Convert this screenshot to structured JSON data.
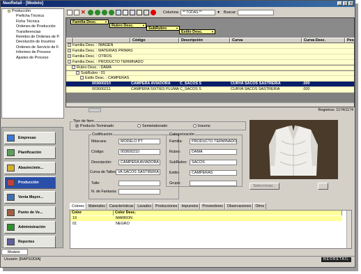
{
  "window": {
    "title": "NeoRetail - [Modelo]",
    "brand": "NEORETAIL"
  },
  "tree": {
    "root": "Producción",
    "items": [
      "Preficha Técnica",
      "Ficha Técnica",
      "Ordenes de Producción",
      "Transferencias",
      "Remitos de Ordenes de P.",
      "Devolución de Insumos",
      "Ordenes de Servicio de F.",
      "Informes de Proceso",
      "Ajustes de Proceso"
    ]
  },
  "sidebar": {
    "items": [
      {
        "label": "Empresas",
        "color": "#3a78d4"
      },
      {
        "label": "Planificación",
        "color": "#5aa05a"
      },
      {
        "label": "Abastecimie...",
        "color": "#d4b030"
      },
      {
        "label": "Producción",
        "color": "#c04040"
      },
      {
        "label": "Venta Mayor...",
        "color": "#4070b0"
      },
      {
        "label": "Punto de Ve...",
        "color": "#a06040"
      },
      {
        "label": "Administración",
        "color": "#309030"
      },
      {
        "label": "Reportes",
        "color": "#6060a0"
      }
    ],
    "selected": "Producción"
  },
  "module_tab": "Modelo",
  "status": {
    "user": "Usuario: [RAPSODIA]"
  },
  "toolbar": {
    "columna_label": "Columna:",
    "columna_value": "** TODAS **",
    "buscar_label": "Buscar:"
  },
  "group_buttons": [
    "Familia Desc.",
    "Rubro Desc.",
    "SubRubro",
    "Estilo Desc."
  ],
  "grid": {
    "columns": [
      "Código",
      "Descripción",
      "Curva",
      "Curva Desc.",
      "Peso"
    ],
    "groups": [
      {
        "text": "Familia Desc. : IMAGEN",
        "sign": "+"
      },
      {
        "text": "Familia Desc. : MATERIAS PRIMAS",
        "sign": "+"
      },
      {
        "text": "Familia Desc. : OTROS",
        "sign": "+"
      },
      {
        "text": "Familia Desc. : PRODUCTO TERMINADO",
        "sign": "-"
      },
      {
        "text": "Rubro Desc. : DAMA",
        "sign": "-"
      },
      {
        "text": "SubRubro : 01",
        "sign": "-"
      },
      {
        "text": "Estilo Desc. : CAMPERAS",
        "sign": "-"
      }
    ],
    "rows": [
      {
        "codigo": "003600210",
        "desc": "CAMPERA AVIADORA",
        "curva": "C_SACOS S",
        "curva_desc": "CURVA SACOS SASTRERIA",
        "peso": ".000",
        "selected": true
      },
      {
        "codigo": "003600211",
        "desc": "CAMPERA SIXTIES PLUMAS",
        "curva": "C_SACOS S",
        "curva_desc": "CURVA SACOS SASTRERIA",
        "peso": ".000",
        "selected": false
      }
    ],
    "registros": "Registros: 1174/1174"
  },
  "form": {
    "tipo_legend": "Tipo de Item",
    "radios": [
      {
        "label": "Producto Terminado",
        "on": true
      },
      {
        "label": "Semielaborado",
        "on": false
      },
      {
        "label": "Insumo",
        "on": false
      }
    ],
    "codif_legend": "Codificación",
    "fields": [
      {
        "label": "Máscara:",
        "value": "MODELO PT"
      },
      {
        "label": "Código:",
        "value": "003600210"
      },
      {
        "label": "Descripción:",
        "value": "CAMPERA AVIADORA"
      },
      {
        "label": "Curva de Talles/Tamaños:",
        "value": "VA SACOS SASTRERIA"
      },
      {
        "label": "Talle:",
        "value": ""
      },
      {
        "label": "N. de Fantasía:",
        "value": ""
      }
    ],
    "categ_legend": "Categorización",
    "cats": [
      {
        "label": "Familia:",
        "value": "PRODUCTO TERMINADO"
      },
      {
        "label": "Rubro:",
        "value": "DAMA"
      },
      {
        "label": "SubRubro:",
        "value": "SACOS"
      },
      {
        "label": "Estilo:",
        "value": "CAMPERAS"
      },
      {
        "label": "Grupo:",
        "value": ""
      }
    ],
    "seleccionar": "Seleccionar..."
  },
  "tabs": [
    "Colores",
    "Materiales",
    "Características",
    "Lavados",
    "Producciones",
    "Impuestos",
    "Proveedores",
    "Observaciones",
    "Otros"
  ],
  "subgrid": {
    "columns": [
      "Color",
      "Color Desc."
    ],
    "rows": [
      {
        "color": "19",
        "desc": "MARRON",
        "selected": true
      },
      {
        "color": "01",
        "desc": "NEGRO",
        "selected": false
      }
    ]
  }
}
